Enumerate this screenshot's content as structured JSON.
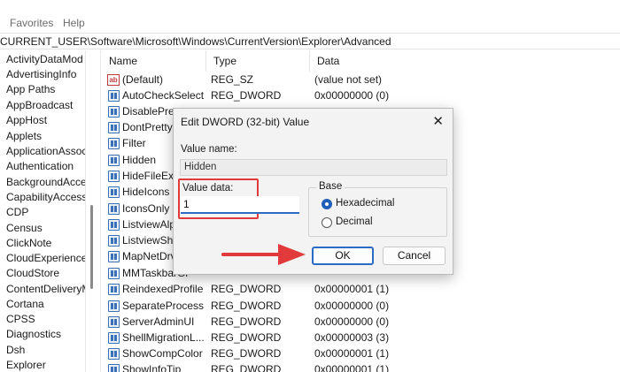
{
  "menu": {
    "favorites": "Favorites",
    "help": "Help"
  },
  "address": "CURRENT_USER\\Software\\Microsoft\\Windows\\CurrentVersion\\Explorer\\Advanced",
  "tree": [
    "ActivityDataMod",
    "AdvertisingInfo",
    "App Paths",
    "AppBroadcast",
    "AppHost",
    "Applets",
    "ApplicationAssoc",
    "Authentication",
    "BackgroundAcce",
    "CapabilityAccess",
    "CDP",
    "Census",
    "ClickNote",
    "CloudExperience",
    "CloudStore",
    "ContentDeliveryM",
    "Cortana",
    "CPSS",
    "Diagnostics",
    "Dsh",
    "Explorer"
  ],
  "columns": {
    "name": "Name",
    "type": "Type",
    "data": "Data"
  },
  "values": [
    {
      "name": "(Default)",
      "type": "REG_SZ",
      "data": "(value not set)"
    },
    {
      "name": "AutoCheckSelect",
      "type": "REG_DWORD",
      "data": "0x00000000 (0)"
    },
    {
      "name": "DisablePrev",
      "type": "",
      "data": ""
    },
    {
      "name": "DontPrettyP",
      "type": "",
      "data": ""
    },
    {
      "name": "Filter",
      "type": "",
      "data": ""
    },
    {
      "name": "Hidden",
      "type": "",
      "data": ""
    },
    {
      "name": "HideFileExt",
      "type": "",
      "data": ""
    },
    {
      "name": "HideIcons",
      "type": "",
      "data": ""
    },
    {
      "name": "IconsOnly",
      "type": "",
      "data": ""
    },
    {
      "name": "ListviewAlp",
      "type": "",
      "data": ""
    },
    {
      "name": "ListviewSha",
      "type": "",
      "data": ""
    },
    {
      "name": "MapNetDrv",
      "type": "",
      "data": ""
    },
    {
      "name": "MMTaskbarGl",
      "type": "",
      "data": ""
    },
    {
      "name": "ReindexedProfile",
      "type": "REG_DWORD",
      "data": "0x00000001 (1)"
    },
    {
      "name": "SeparateProcess",
      "type": "REG_DWORD",
      "data": "0x00000000 (0)"
    },
    {
      "name": "ServerAdminUI",
      "type": "REG_DWORD",
      "data": "0x00000000 (0)"
    },
    {
      "name": "ShellMigrationL...",
      "type": "REG_DWORD",
      "data": "0x00000003 (3)"
    },
    {
      "name": "ShowCompColor",
      "type": "REG_DWORD",
      "data": "0x00000001 (1)"
    },
    {
      "name": "ShowInfoTip",
      "type": "REG_DWORD",
      "data": "0x00000001 (1)"
    }
  ],
  "dialog": {
    "title": "Edit DWORD (32-bit) Value",
    "close": "✕",
    "value_name_label": "Value name:",
    "value_name": "Hidden",
    "value_data_label": "Value data:",
    "value_data": "1",
    "base_label": "Base",
    "hex_label": "Hexadecimal",
    "dec_label": "Decimal",
    "ok": "OK",
    "cancel": "Cancel"
  },
  "annotation_colors": {
    "highlight": "#e23a3a",
    "arrow": "#e23a3a"
  }
}
